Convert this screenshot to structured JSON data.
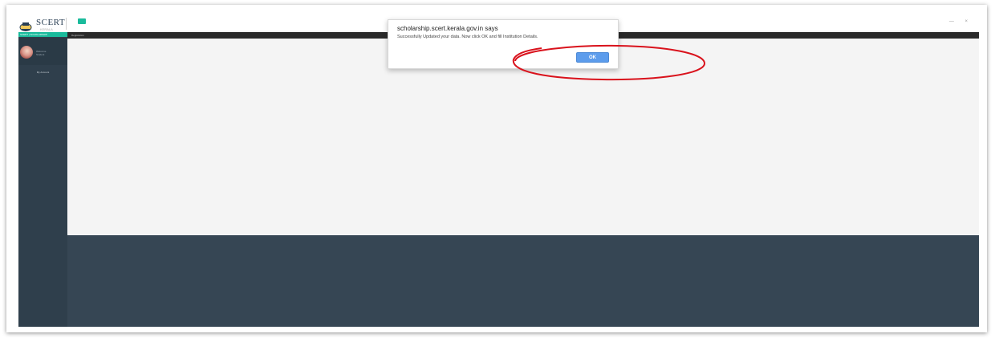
{
  "header": {
    "logo_text": "SCERT",
    "logo_subtitle": "KERALA",
    "window_controls": "— ×"
  },
  "sidebar": {
    "title": "SCERT | SCHOLARSHIP",
    "welcome_line1": "Welcome",
    "welcome_line2": "Student",
    "nav_item": "My Account"
  },
  "breadcrumb": {
    "text": "Registration"
  },
  "dialog": {
    "title": "scholarship.scert.kerala.gov.in says",
    "message": "Successfully Updated your data. Now click OK and fill Institution Details.",
    "ok_label": "OK"
  },
  "colors": {
    "accent": "#1abb9c",
    "sidebar": "#2f3f4c",
    "footer": "#364654",
    "ok_button": "#5c9cec",
    "annotation": "#d9121c"
  }
}
